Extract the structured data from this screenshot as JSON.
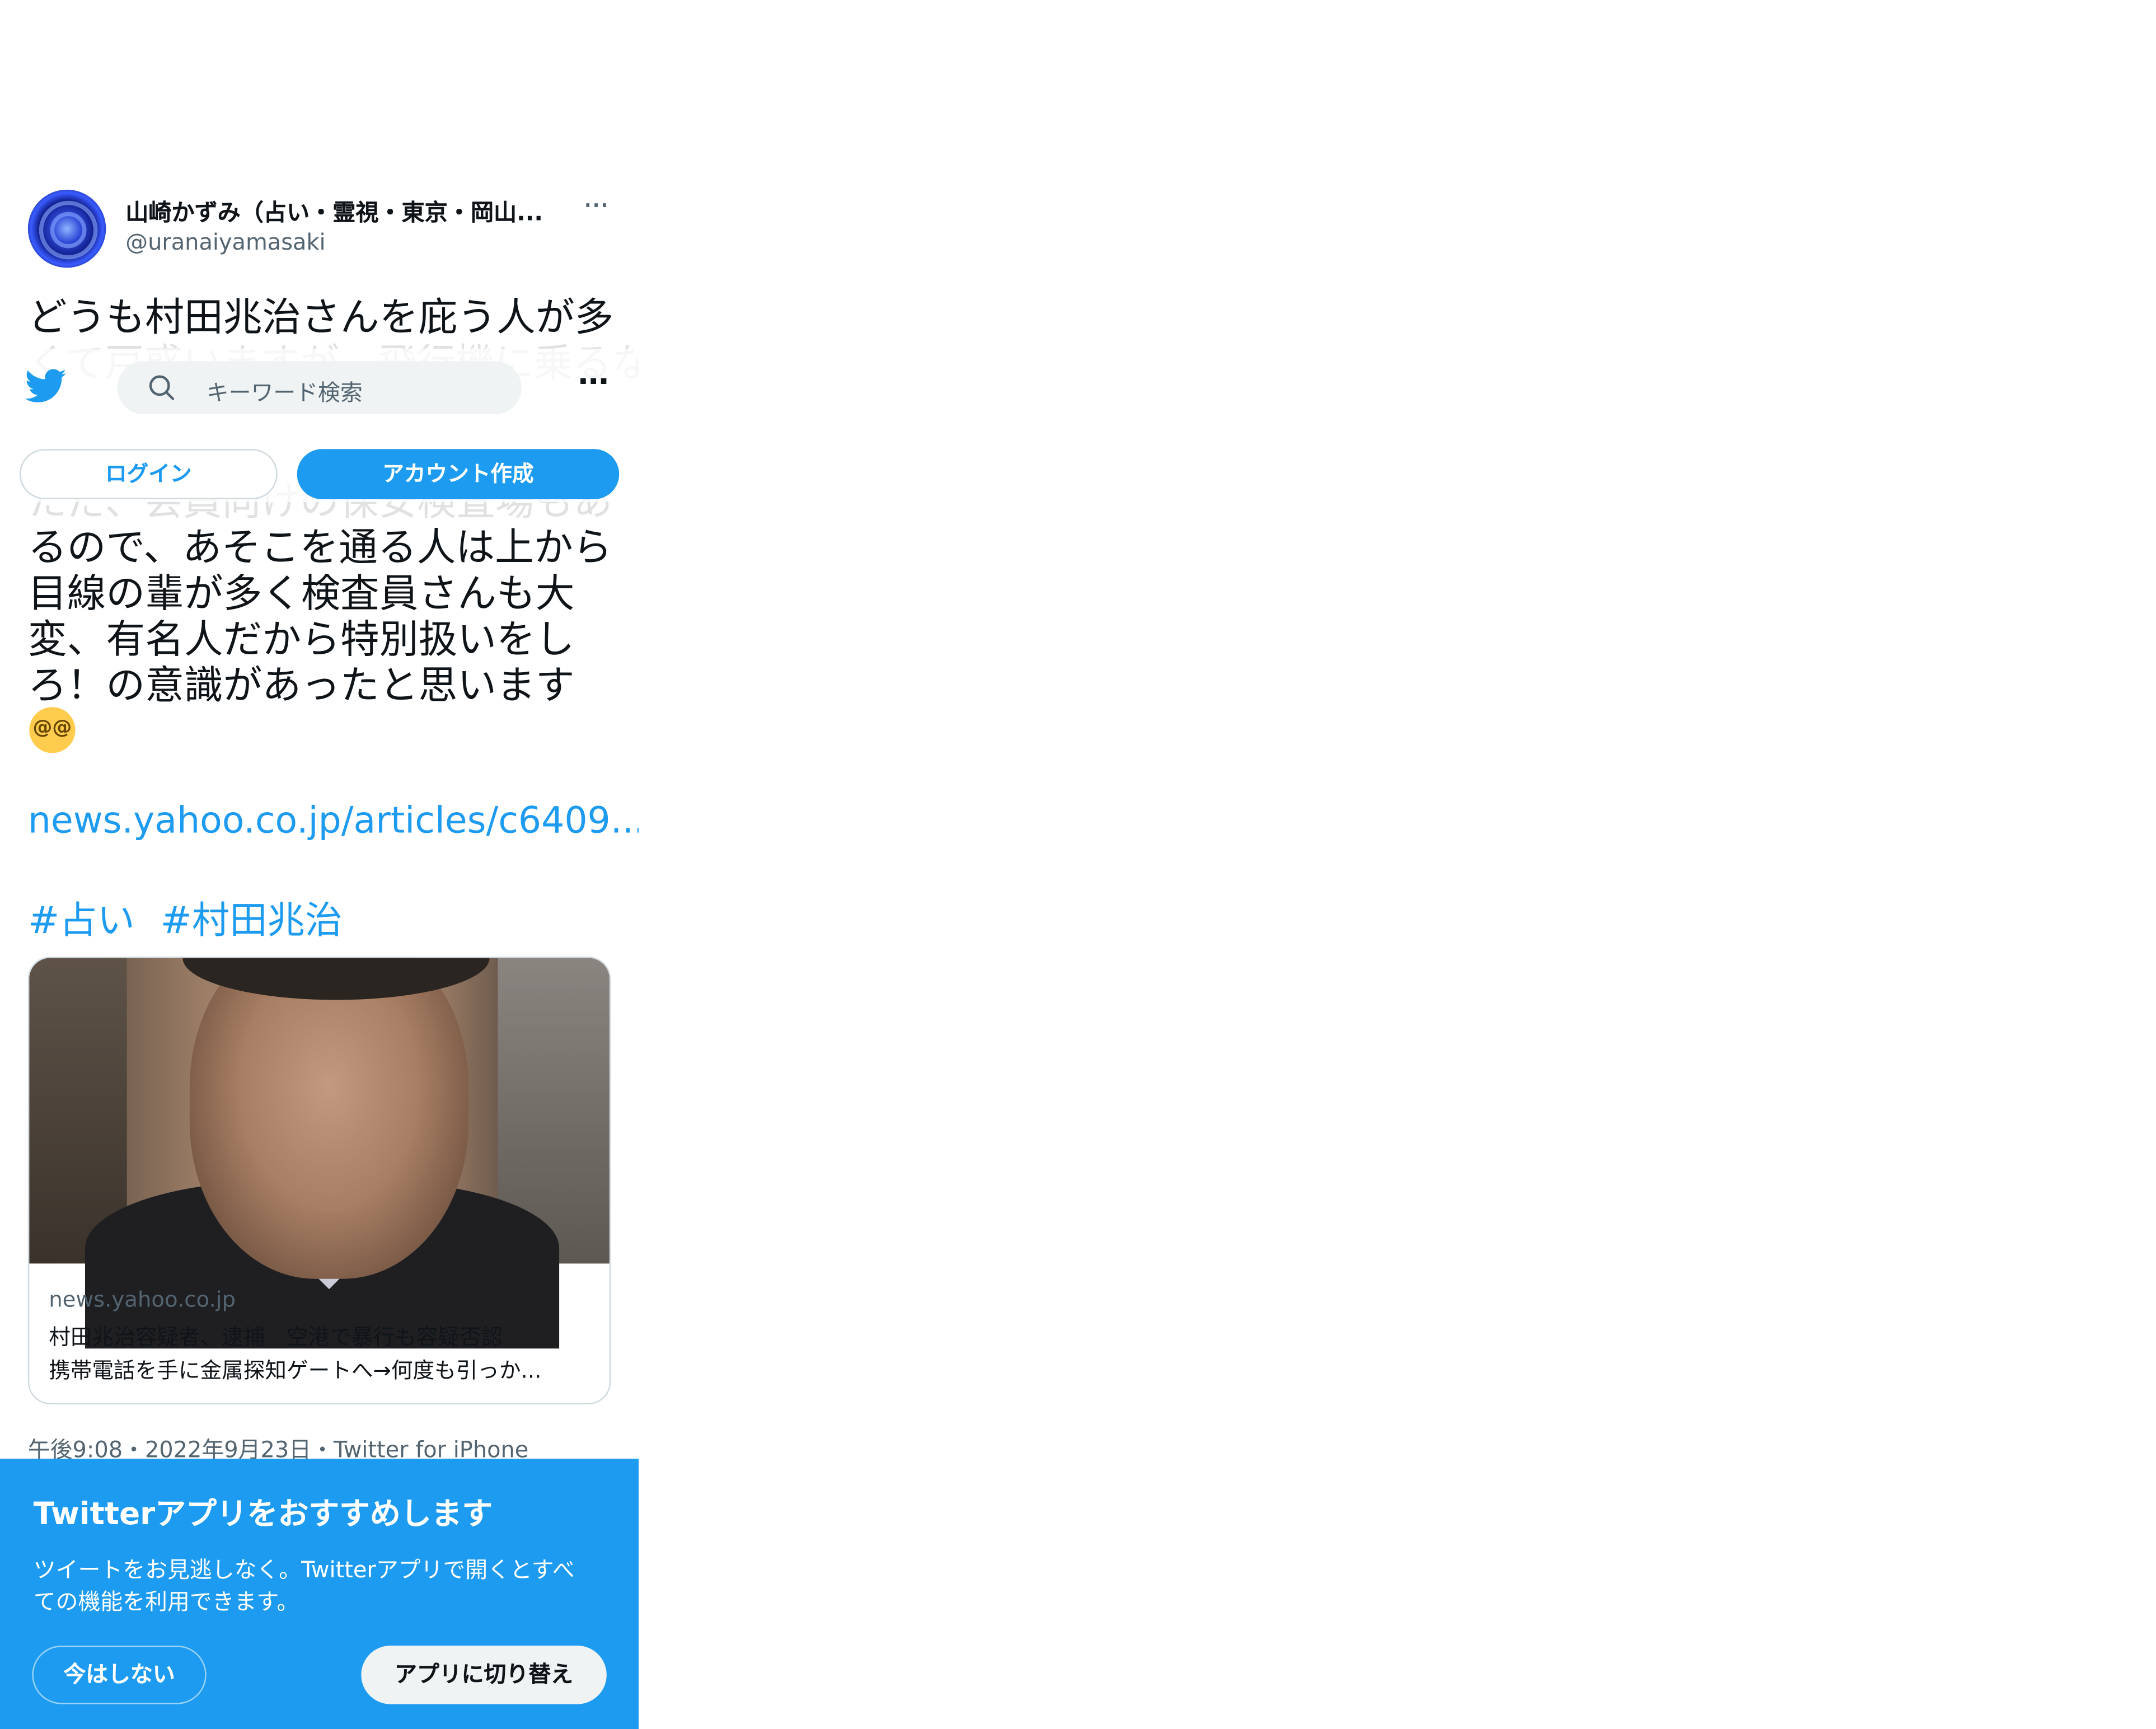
{
  "tweet": {
    "author_name": "山崎かずみ（占い・霊視・東京・岡山...",
    "author_handle": "@uranaiyamasaki",
    "more": "···",
    "lines": [
      "どうも村田兆治さんを庇う人が多",
      "くて戸惑いますが、飛行機に乗るな",
      "ただ、会員向けの保安検査場もあ",
      "るので、あそこを通る人は上から",
      "目線の輩が多く検査員さんも大",
      "変、有名人だから特別扱いをし",
      "ろ！の意識があったと思います"
    ],
    "emoji": "😵‍💫",
    "link": "news.yahoo.co.jp/articles/c6409...",
    "hashtags": [
      "#占い",
      "#村田兆治"
    ],
    "card": {
      "domain": "news.yahoo.co.jp",
      "title_line1": "村田兆治容疑者、逮捕　空港で暴行も容疑否認",
      "title_line2": "携帯電話を手に金属探知ゲートへ→何度も引っか..."
    },
    "timestamp": "午後9:08・2022年9月23日・Twitter for iPhone"
  },
  "topbar": {
    "search_placeholder": "キーワード検索",
    "more": "···",
    "login_label": "ログイン",
    "signup_label": "アカウント作成"
  },
  "banner": {
    "title": "Twitterアプリをおすすめします",
    "body_line1": "ツイートをお見逃しなく。Twitterアプリで開くとすべ",
    "body_line2": "ての機能を利用できます。",
    "not_now_label": "今はしない",
    "switch_label": "アプリに切り替え"
  },
  "colors": {
    "accent": "#1d9bf0",
    "text": "#0f1419",
    "secondary": "#536471"
  }
}
